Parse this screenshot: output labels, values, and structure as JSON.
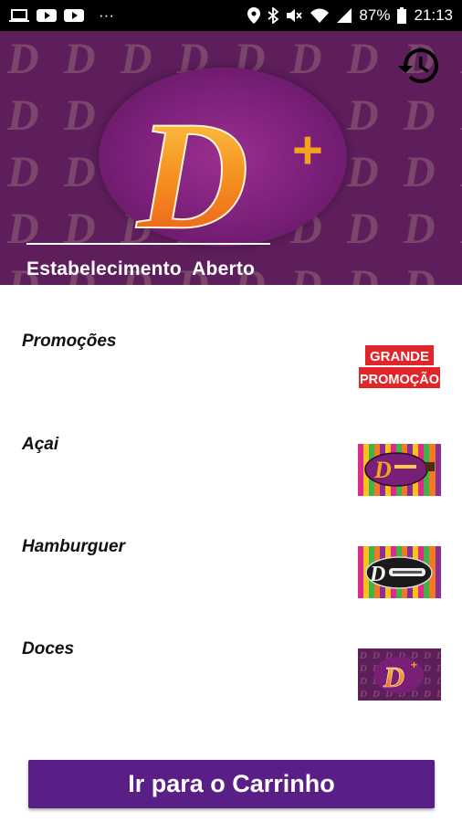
{
  "status_bar": {
    "battery": "87%",
    "time": "21:13",
    "overflow": "···"
  },
  "header": {
    "status_text": "Estabelecimento  Aberto",
    "logo_letter": "D",
    "logo_plus": "+",
    "history_icon": "history-icon"
  },
  "categories": [
    {
      "label": "Promoções",
      "thumb": "promo"
    },
    {
      "label": "Açai",
      "thumb": "acai"
    },
    {
      "label": "Hamburguer",
      "thumb": "burger"
    },
    {
      "label": "Doces",
      "thumb": "doces"
    }
  ],
  "promo_thumb": {
    "line1": "GRANDE",
    "line2": "PROMOÇÃO"
  },
  "cart_button": {
    "label": "Ir para o Carrinho"
  },
  "colors": {
    "header_bg": "#5e1e5c",
    "oval": "#7a1f78",
    "logo_orange": "#f47a1f",
    "cart_button": "#5a1e87"
  }
}
